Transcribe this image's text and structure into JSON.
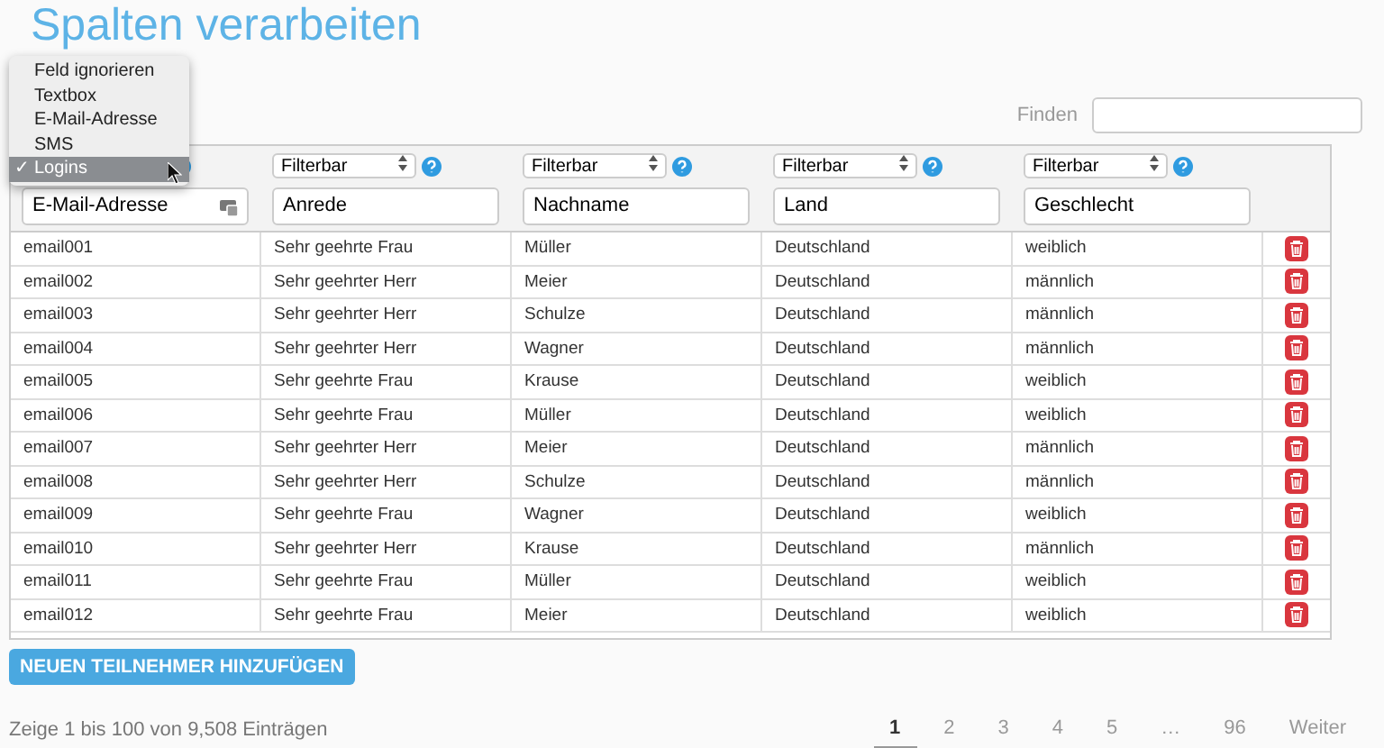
{
  "title": "Spalten verarbeiten",
  "type_menu": [
    {
      "label": "Feld ignorieren",
      "selected": false
    },
    {
      "label": "Textbox",
      "selected": false
    },
    {
      "label": "E-Mail-Adresse",
      "selected": false
    },
    {
      "label": "SMS",
      "selected": false
    },
    {
      "label": "Logins",
      "selected": true
    }
  ],
  "type_menu_check": "✓",
  "search": {
    "label": "Finden"
  },
  "columns": [
    {
      "kind": "email",
      "field": "E-Mail-Adresse"
    },
    {
      "kind": "filter",
      "select": "Filterbar",
      "field": "Anrede"
    },
    {
      "kind": "filter",
      "select": "Filterbar",
      "field": "Nachname"
    },
    {
      "kind": "filter",
      "select": "Filterbar",
      "field": "Land"
    },
    {
      "kind": "filter",
      "select": "Filterbar",
      "field": "Geschlecht"
    }
  ],
  "rows": [
    [
      "email001",
      "Sehr geehrte Frau",
      "Müller",
      "Deutschland",
      "weiblich"
    ],
    [
      "email002",
      "Sehr geehrter Herr",
      "Meier",
      "Deutschland",
      "männlich"
    ],
    [
      "email003",
      "Sehr geehrter Herr",
      "Schulze",
      "Deutschland",
      "männlich"
    ],
    [
      "email004",
      "Sehr geehrter Herr",
      "Wagner",
      "Deutschland",
      "männlich"
    ],
    [
      "email005",
      "Sehr geehrte Frau",
      "Krause",
      "Deutschland",
      "weiblich"
    ],
    [
      "email006",
      "Sehr geehrte Frau",
      "Müller",
      "Deutschland",
      "weiblich"
    ],
    [
      "email007",
      "Sehr geehrter Herr",
      "Meier",
      "Deutschland",
      "männlich"
    ],
    [
      "email008",
      "Sehr geehrter Herr",
      "Schulze",
      "Deutschland",
      "männlich"
    ],
    [
      "email009",
      "Sehr geehrte Frau",
      "Wagner",
      "Deutschland",
      "weiblich"
    ],
    [
      "email010",
      "Sehr geehrter Herr",
      "Krause",
      "Deutschland",
      "männlich"
    ],
    [
      "email011",
      "Sehr geehrte Frau",
      "Müller",
      "Deutschland",
      "weiblich"
    ],
    [
      "email012",
      "Sehr geehrte Frau",
      "Meier",
      "Deutschland",
      "weiblich"
    ]
  ],
  "add_button": "NEUEN TEILNEHMER HINZUFÜGEN",
  "summary": "Zeige 1 bis 100 von 9,508 Einträgen",
  "pages": [
    {
      "label": "1",
      "selected": true
    },
    {
      "label": "2",
      "selected": false
    },
    {
      "label": "3",
      "selected": false
    },
    {
      "label": "4",
      "selected": false
    },
    {
      "label": "5",
      "selected": false
    },
    {
      "label": "…",
      "selected": false
    },
    {
      "label": "96",
      "selected": false
    },
    {
      "label": "Weiter",
      "selected": false
    }
  ]
}
